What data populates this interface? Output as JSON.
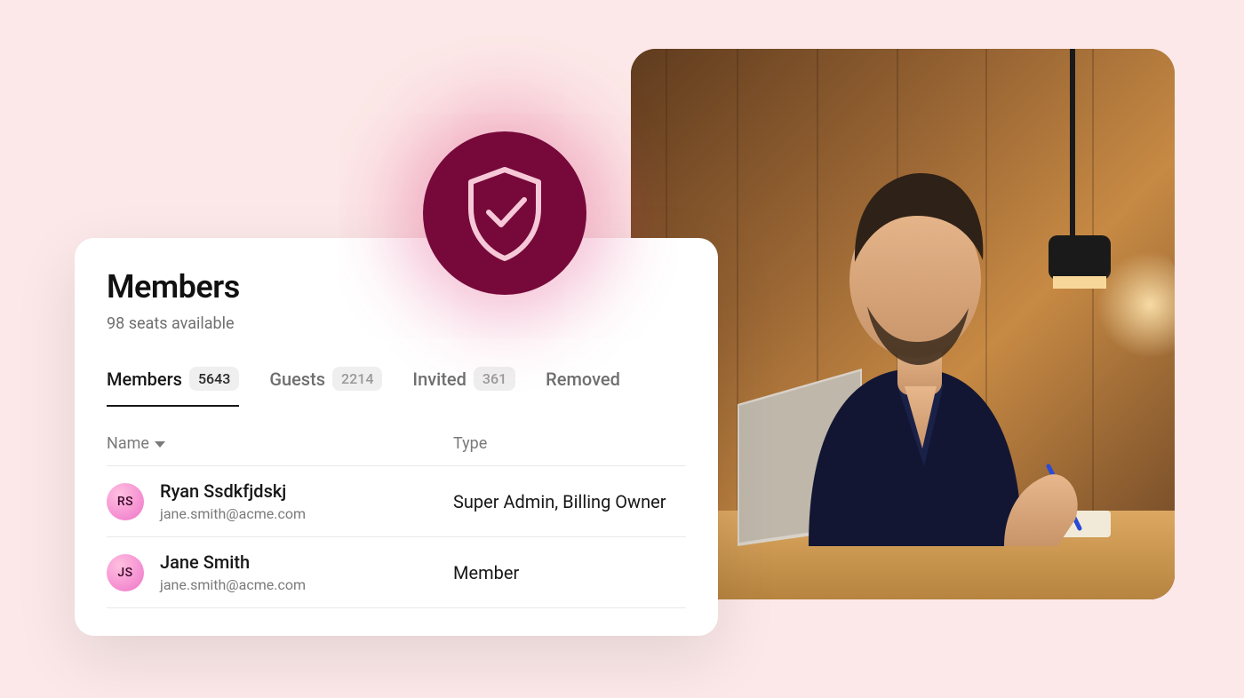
{
  "panel": {
    "title": "Members",
    "subtitle": "98 seats available"
  },
  "tabs": [
    {
      "label": "Members",
      "count": "5643",
      "active": true
    },
    {
      "label": "Guests",
      "count": "2214",
      "active": false
    },
    {
      "label": "Invited",
      "count": "361",
      "active": false
    },
    {
      "label": "Removed",
      "count": "",
      "active": false
    }
  ],
  "columns": {
    "name": "Name",
    "type": "Type"
  },
  "rows": [
    {
      "initials": "RS",
      "name": "Ryan Ssdkfjdskj",
      "email": "jane.smith@acme.com",
      "type": "Super Admin, Billing Owner"
    },
    {
      "initials": "JS",
      "name": "Jane Smith",
      "email": "jane.smith@acme.com",
      "type": "Member"
    }
  ],
  "icons": {
    "shield": "shield-check"
  }
}
